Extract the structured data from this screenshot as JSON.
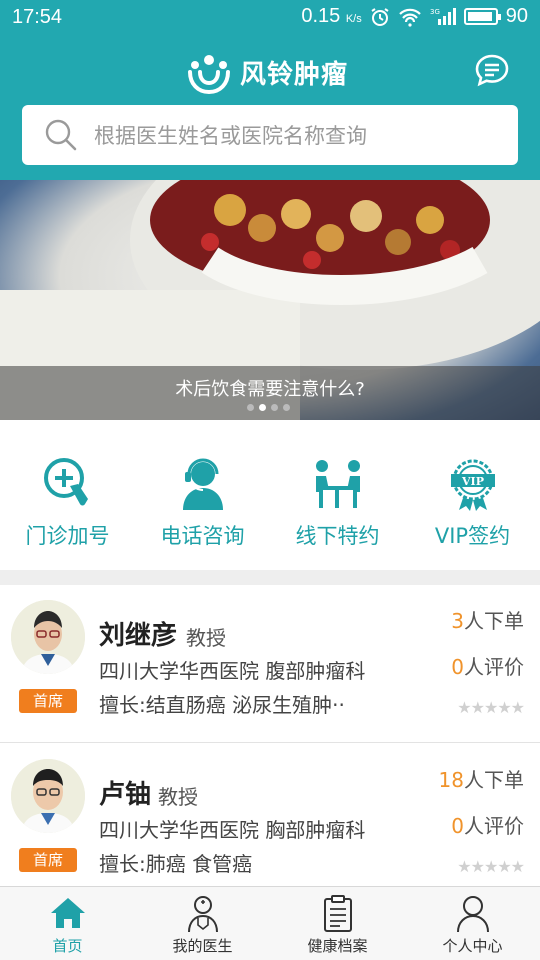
{
  "status_bar": {
    "time": "17:54",
    "net_speed": "0.15",
    "net_unit": "K/s",
    "signal": "3G",
    "battery": "90"
  },
  "header": {
    "app_name": "风铃肿瘤",
    "logo_icon": "people-logo-icon",
    "chat_icon": "chat-bubble-icon"
  },
  "search": {
    "placeholder": "根据医生姓名或医院名称查询"
  },
  "banner": {
    "caption": "术后饮食需要注意什么?",
    "page_count": 4,
    "active_page": 2
  },
  "services": [
    {
      "label": "门诊加号",
      "icon": "clinic-plus-icon"
    },
    {
      "label": "电话咨询",
      "icon": "phone-consult-icon"
    },
    {
      "label": "线下特约",
      "icon": "offline-meeting-icon"
    },
    {
      "label": "VIP签约",
      "icon": "vip-badge-icon"
    }
  ],
  "doctors": [
    {
      "name": "刘继彦",
      "title": "教授",
      "badge": "首席",
      "hospital": "四川大学华西医院 腹部肿瘤科",
      "specialty": "擅长:结直肠癌 泌尿生殖肿··",
      "orders_num": "3",
      "orders_suffix": "人下单",
      "reviews_num": "0",
      "reviews_suffix": "人评价",
      "rating": 0
    },
    {
      "name": "卢铀",
      "title": "教授",
      "badge": "首席",
      "hospital": "四川大学华西医院 胸部肿瘤科",
      "specialty": "擅长:肺癌 食管癌",
      "orders_num": "18",
      "orders_suffix": "人下单",
      "reviews_num": "0",
      "reviews_suffix": "人评价",
      "rating": 0
    }
  ],
  "tabbar": [
    {
      "label": "首页",
      "icon": "home-icon",
      "active": true
    },
    {
      "label": "我的医生",
      "icon": "doctor-icon",
      "active": false
    },
    {
      "label": "健康档案",
      "icon": "clipboard-icon",
      "active": false
    },
    {
      "label": "个人中心",
      "icon": "person-icon",
      "active": false
    }
  ],
  "colors": {
    "primary": "#22a8b0",
    "accent_text": "#1fa1a8",
    "badge": "#f07e1e",
    "count": "#f0932b"
  }
}
